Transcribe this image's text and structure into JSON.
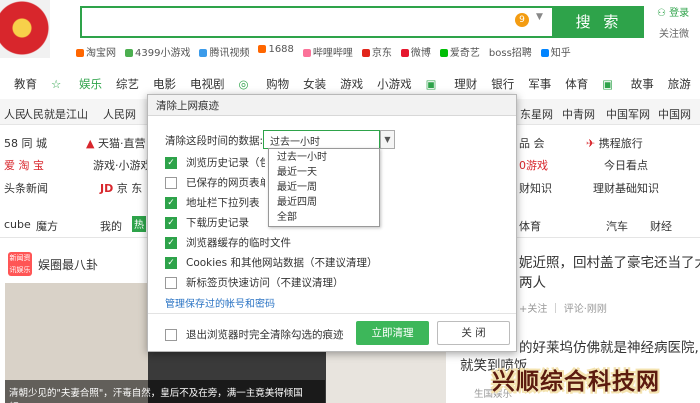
{
  "search": {
    "count_badge": "9",
    "button_label": "搜 索",
    "login_label": "登录",
    "follow_label": "关注微"
  },
  "quicklinks": [
    "淘宝网",
    "4399小游戏",
    "腾讯视频",
    "1688",
    "哔哩哔哩",
    "京东",
    "微博",
    "爱奇艺",
    "boss招聘",
    "知乎"
  ],
  "category_nav": [
    "教育",
    "娱乐",
    "综艺",
    "电影",
    "电视剧",
    "购物",
    "女装",
    "游戏",
    "小游戏",
    "理财",
    "银行",
    "军事",
    "体育",
    "故事",
    "旅游"
  ],
  "secondary_nav": {
    "left": [
      "人民",
      "人民就是江山",
      "人民网"
    ],
    "right": [
      "东星网",
      "中青网",
      "中国军网",
      "中国网"
    ]
  },
  "background": {
    "left_links": [
      "58 同 城",
      "天猫·直营",
      "爱 淘 宝",
      "游戏·小游戏",
      "头条新闻",
      "京 东"
    ],
    "right_links": [
      "品 会",
      "携程旅行",
      "0游戏",
      "今日看点",
      "财知识",
      "理财基础知识"
    ],
    "tabs": [
      "cube",
      "魔方",
      "我的",
      "热",
      "体育",
      "汽车",
      "财经"
    ],
    "feed_title": "娱圈最八卦",
    "tag_orange": "新闻资讯娱乐",
    "headline_1": "妮近照，回村盖了豪宅还当了大",
    "headline_2": "两人",
    "meta_1": "+关注 ｜ 评论·刚刚",
    "headline_3": "的好莱坞仿佛就是神经病医院,",
    "headline_4": "就笑到喷饭",
    "meta_2": "生国娱乐",
    "caption": "清朝少见的\"夫妻合照\"，汗毒自然，皇后不及在旁，满一主竟美得倾国倾...",
    "watermark": "兴顺综合科技网"
  },
  "dialog": {
    "title": "清除上网痕迹",
    "time_label": "清除这段时间的数据:",
    "selected_range": "过去一小时",
    "range_options": [
      "过去一小时",
      "最近一天",
      "最近一周",
      "最近四周",
      "全部"
    ],
    "checkboxes": [
      {
        "label": "浏览历史记录（包",
        "checked": true
      },
      {
        "label": "已保存的网页表单",
        "checked": false
      },
      {
        "label": "地址栏下拉列表",
        "checked": true
      },
      {
        "label": "下载历史记录",
        "checked": true
      },
      {
        "label": "浏览器缓存的临时文件",
        "checked": true
      },
      {
        "label": "Cookies 和其他网站数据（不建议清理）",
        "checked": true
      },
      {
        "label": "新标签页快速访问（不建议清理）",
        "checked": false
      }
    ],
    "manage_link": "管理保存过的帐号和密码",
    "exit_checkbox": {
      "label": "退出浏览器时完全清除勾选的痕迹",
      "checked": false
    },
    "clean_button": "立即清理",
    "close_button": "关 闭"
  },
  "colors": {
    "accent_green": "#2ea34a",
    "link_blue": "#2b74c4",
    "arrow_red": "#e02a2a"
  }
}
